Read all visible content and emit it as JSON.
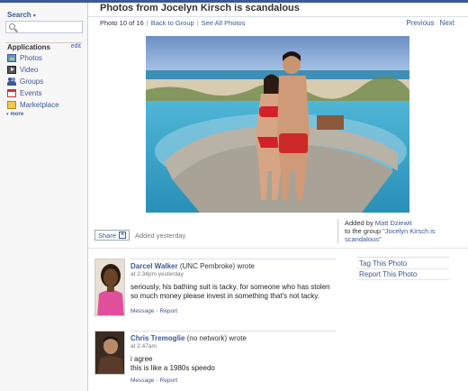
{
  "sidebar": {
    "search_label": "Search",
    "apps_title": "Applications",
    "apps_edit": "edit",
    "apps": [
      {
        "label": "Photos",
        "icon": "photos-icon"
      },
      {
        "label": "Video",
        "icon": "video-icon"
      },
      {
        "label": "Groups",
        "icon": "groups-icon"
      },
      {
        "label": "Events",
        "icon": "events-icon"
      },
      {
        "label": "Marketplace",
        "icon": "marketplace-icon"
      }
    ],
    "more": "more"
  },
  "page": {
    "title": "Photos from Jocelyn Kirsch is scandalous",
    "photo_counter": "Photo 10 of 16",
    "back_link": "Back to Group",
    "see_all": "See All Photos",
    "previous": "Previous",
    "next": "Next"
  },
  "photo_meta": {
    "share_label": "Share",
    "added": "Added yesterday",
    "added_by_prefix": "Added by",
    "added_by_name": "Matt Dziewit",
    "group_prefix": "to the group",
    "group_name": "\"Jocelyn Kirsch is scandalous\""
  },
  "actions": {
    "tag": "Tag This Photo",
    "report": "Report This Photo"
  },
  "comments": [
    {
      "author": "Darcel Walker",
      "network": "(UNC Pembroke) wrote",
      "time": "at 2:34pm yesterday",
      "text": "seriously, his bathing suit is tacky. for someone who has stolen so much money please invest in something that's not tacky.",
      "message": "Message",
      "report": "Report"
    },
    {
      "author": "Chris Tremoglie",
      "network": "(no network) wrote",
      "time": "at 2:47am",
      "text_line1": "i agree",
      "text_line2": "this is like a 1980s speedo",
      "message": "Message",
      "report": "Report"
    }
  ]
}
